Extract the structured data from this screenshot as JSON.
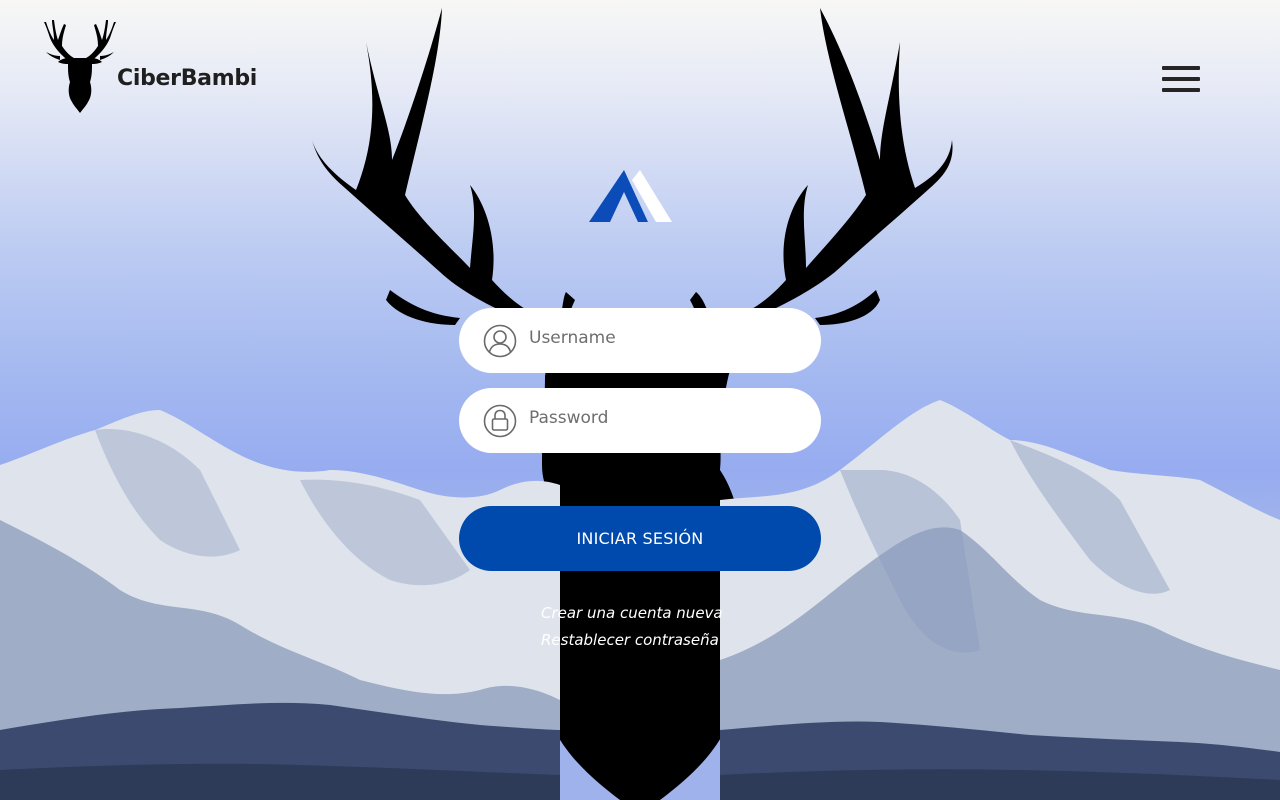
{
  "brand": {
    "name": "CiberBambi",
    "logo_icon": "deer-head-icon"
  },
  "header": {
    "menu_icon": "hamburger-menu-icon"
  },
  "app_mark_icon": "mountain-peaks-icon",
  "login_form": {
    "username": {
      "placeholder": "Username",
      "value": "",
      "icon": "user-icon"
    },
    "password": {
      "placeholder": "Password",
      "value": "",
      "icon": "lock-icon"
    },
    "submit_label": "INICIAR SESIÓN",
    "links": {
      "create_account": "Crear una cuenta nueva",
      "reset_password": "Restablecer contraseña"
    }
  },
  "colors": {
    "primary": "#004aad",
    "brand_text": "#1f1f1f",
    "link_text": "#ffffff",
    "sky_top": "#f7f7f5",
    "sky_bottom": "#97acf0"
  }
}
